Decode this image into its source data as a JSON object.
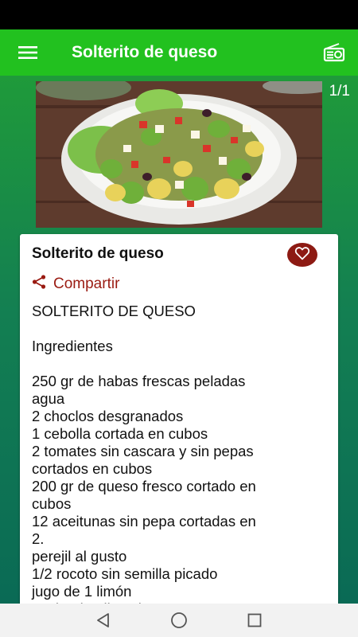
{
  "app_bar": {
    "title": "Solterito de queso",
    "menu_icon": "hamburger-menu-icon",
    "action_icon": "radio-icon"
  },
  "gallery": {
    "counter": "1/1"
  },
  "card": {
    "title": "Solterito de queso",
    "favorite_icon": "heart-icon",
    "share_icon": "share-icon",
    "share_label": "Compartir",
    "recipe_lines": [
      "SOLTERITO DE QUESO",
      "",
      "Ingredientes",
      "",
      "250 gr de habas frescas peladas",
      "agua",
      "2 choclos desgranados",
      "1 cebolla cortada en cubos",
      "2 tomates sin cascara y sin pepas",
      "cortados en cubos",
      "200 gr de queso fresco cortado en",
      "cubos",
      "12 aceitunas sin pepa cortadas en",
      "2.",
      "perejil al gusto",
      "1/2 rocoto sin semilla picado",
      "jugo de 1 limón",
      "aceite de oliva al gusto"
    ]
  },
  "colors": {
    "app_bar": "#22c11f",
    "accent": "#9a1b12",
    "background": "#137f52"
  },
  "nav": {
    "back_icon": "back-triangle-icon",
    "home_icon": "home-circle-icon",
    "recents_icon": "recents-square-icon"
  }
}
